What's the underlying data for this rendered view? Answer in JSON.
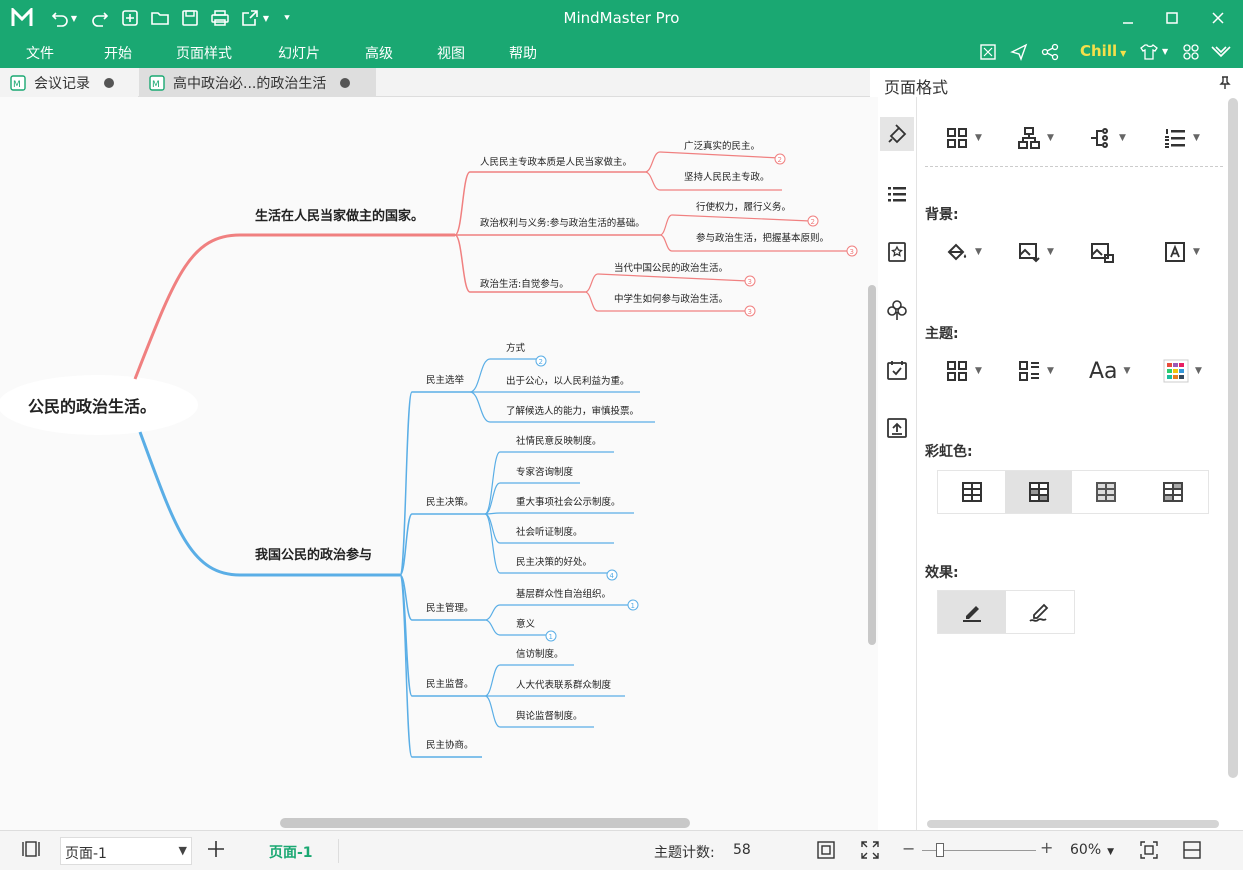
{
  "app": {
    "title": "MindMaster Pro",
    "accent": "#1aa872"
  },
  "menu": [
    "文件",
    "开始",
    "页面样式",
    "幻灯片",
    "高级",
    "视图",
    "帮助"
  ],
  "menu_right": {
    "theme_label": "Chill"
  },
  "tabs": [
    {
      "label": "会议记录"
    },
    {
      "label": "高中政治必...的政治生活"
    }
  ],
  "mindmap": {
    "root": "公民的政治生活。",
    "branch_top": {
      "title": "生活在人民当家做主的国家。",
      "color": "#f08080",
      "children": [
        {
          "label": "人民民主专政本质是人民当家做主。",
          "count": "2",
          "leaves": [
            "广泛真实的民主。",
            "坚持人民民主专政。"
          ]
        },
        {
          "label": "政治权利与义务:参与政治生活的基础。",
          "count": "2",
          "leaves": [
            "行使权力，履行义务。",
            "参与政治生活，把握基本原则。"
          ],
          "leaf_count": "3"
        },
        {
          "label": "政治生活:自觉参与。",
          "leaves": [
            "当代中国公民的政治生活。",
            "中学生如何参与政治生活。"
          ],
          "leaf_counts": [
            "3",
            "3"
          ]
        }
      ]
    },
    "branch_bottom": {
      "title": "我国公民的政治参与",
      "color": "#5aaee6",
      "children": [
        {
          "label": "民主选举",
          "leaves": [
            "方式",
            "出于公心，以人民利益为重。",
            "了解候选人的能力，审慎投票。"
          ],
          "leaf_count": "2"
        },
        {
          "label": "民主决策。",
          "leaves": [
            "社情民意反映制度。",
            "专家咨询制度",
            "重大事项社会公示制度。",
            "社会听证制度。",
            "民主决策的好处。"
          ],
          "leaf_count": "4"
        },
        {
          "label": "民主管理。",
          "leaves": [
            "基层群众性自治组织。",
            "意义"
          ],
          "leaf_counts": [
            "1",
            "1"
          ]
        },
        {
          "label": "民主监督。",
          "leaves": [
            "信访制度。",
            "人大代表联系群众制度",
            "舆论监督制度。"
          ]
        },
        {
          "label": "民主协商。",
          "leaves": []
        }
      ]
    }
  },
  "panel": {
    "title": "页面格式",
    "sections": {
      "background": "背景:",
      "theme": "主题:",
      "rainbow": "彩虹色:",
      "effect": "效果:"
    },
    "theme_font_label": "Aa"
  },
  "status": {
    "page_select": "页面-1",
    "page_tab": "页面-1",
    "topic_count_label": "主题计数:",
    "topic_count": "58",
    "zoom": "60%"
  }
}
